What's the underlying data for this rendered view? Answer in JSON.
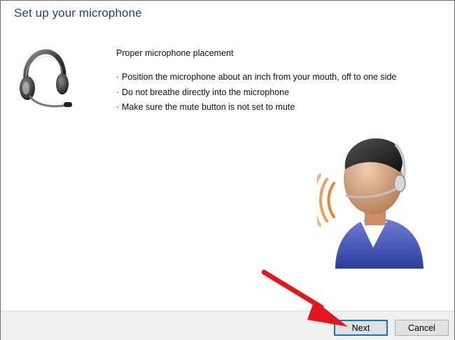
{
  "window": {
    "title": "Set up your microphone"
  },
  "instructions": {
    "heading": "Proper microphone placement",
    "bullets": [
      "Position the microphone about an inch from your mouth, off to one side",
      "Do not breathe directly into the microphone",
      "Make sure the mute button is not set to mute"
    ]
  },
  "buttons": {
    "next_label": "Next",
    "cancel_label": "Cancel"
  },
  "illustrations": {
    "headset_icon": "headset-icon",
    "speaker_icon": "person-speaking-with-headset"
  },
  "colors": {
    "title": "#1e3e9a",
    "accent_button_border": "#0078d7",
    "annotation_arrow": "#e3171b",
    "footer_bg": "#f0f0f0"
  }
}
